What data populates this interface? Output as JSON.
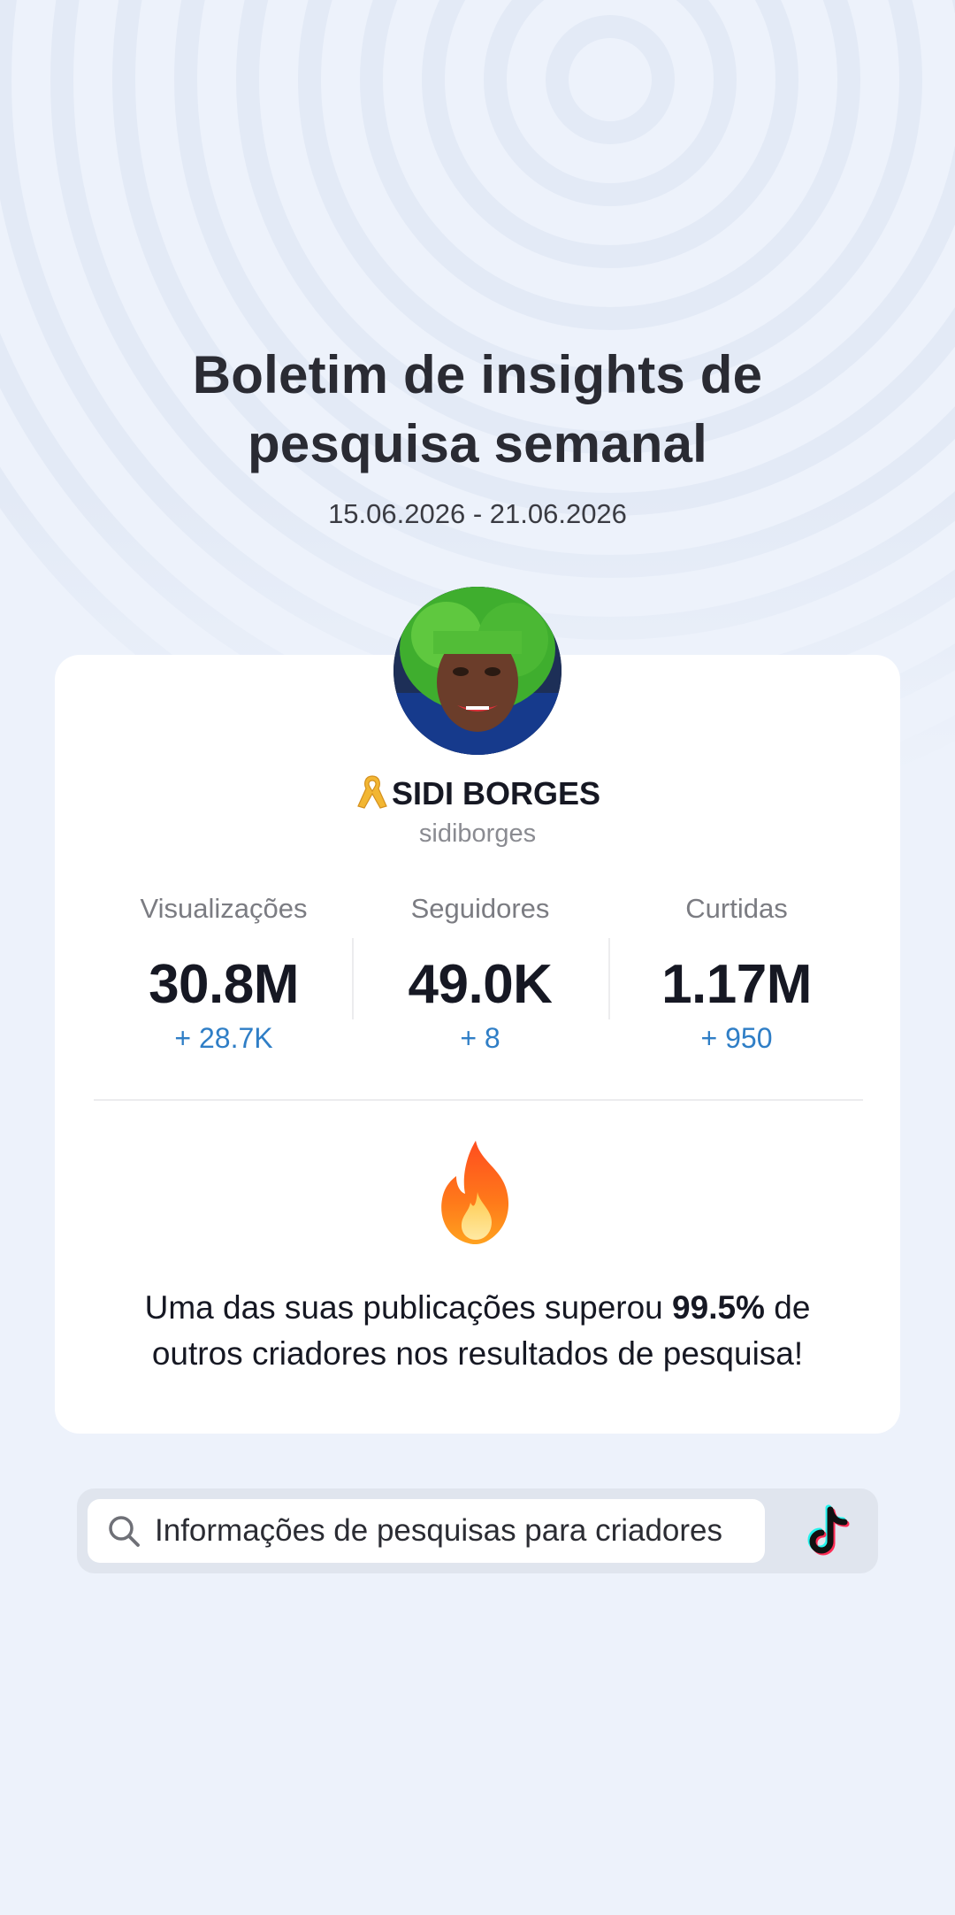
{
  "header": {
    "title_line1": "Boletim de insights de",
    "title_line2": "pesquisa semanal",
    "date_range": "15.06.2026 - 21.06.2026"
  },
  "profile": {
    "ribbon_icon": "ribbon-icon",
    "display_name": "SIDI BORGES",
    "handle": "sidiborges"
  },
  "stats": [
    {
      "label": "Visualizações",
      "value": "30.8M",
      "delta": "+ 28.7K"
    },
    {
      "label": "Seguidores",
      "value": "49.0K",
      "delta": "+ 8"
    },
    {
      "label": "Curtidas",
      "value": "1.17M",
      "delta": "+ 950"
    }
  ],
  "insight": {
    "icon": "fire-icon",
    "text_before": "Uma das suas publicações superou ",
    "highlight": "99.5%",
    "text_after": " de outros criadores nos resultados de pesquisa!"
  },
  "search": {
    "icon": "search-icon",
    "text": "Informações de pesquisas para criadores",
    "brand_icon": "tiktok-icon"
  },
  "colors": {
    "background": "#edf2fb",
    "card": "#ffffff",
    "delta": "#2f7ec6",
    "text_primary": "#161823",
    "text_secondary": "#7b7c82"
  }
}
